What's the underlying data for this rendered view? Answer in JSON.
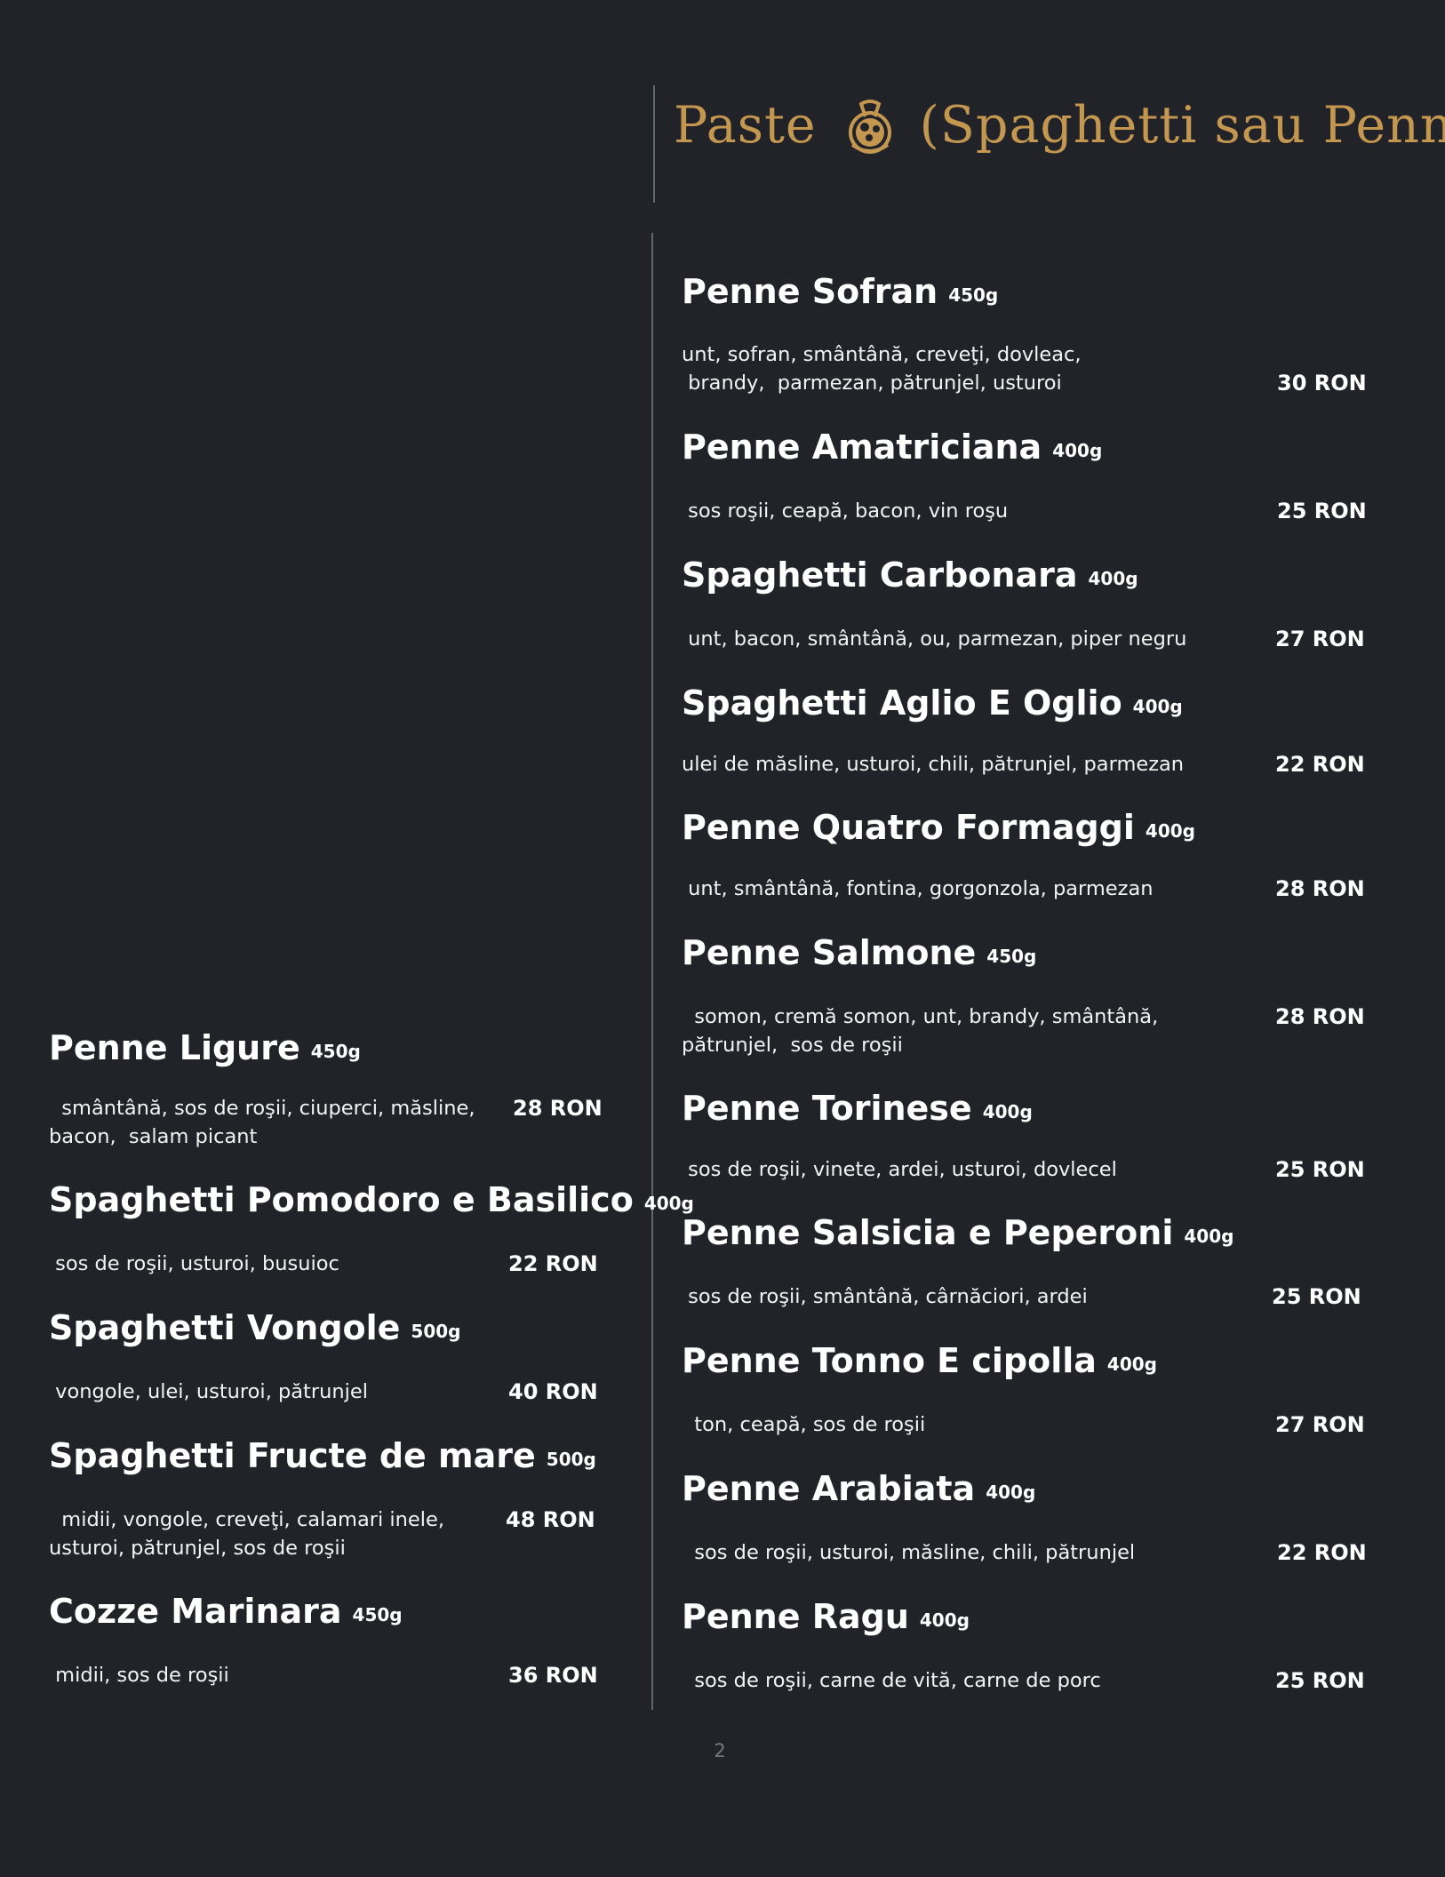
{
  "section": {
    "title_prefix": "Paste",
    "title_suffix": "(Spaghetti sau Penne)",
    "icon": "pasta-bowl-icon",
    "accent_color": "#c3974f",
    "background_color": "#212328"
  },
  "right_column": [
    {
      "name": "Penne Sofran",
      "weight": "450g",
      "desc1": "unt, sofran, smântână, creveţi, dovleac,",
      "desc2": " brandy,  parmezan, pătrunjel, usturoi",
      "price": "30 RON"
    },
    {
      "name": "Penne Amatriciana",
      "weight": "400g",
      "desc1": " sos roşii, ceapă, bacon, vin roşu",
      "desc2": "",
      "price": "25 RON"
    },
    {
      "name": "Spaghetti Carbonara",
      "weight": "400g",
      "desc1": " unt, bacon, smântână, ou, parmezan, piper negru",
      "desc2": "",
      "price": "27 RON"
    },
    {
      "name": "Spaghetti Aglio E Oglio",
      "weight": "400g",
      "desc1": "ulei de măsline, usturoi, chili, pătrunjel, parmezan",
      "desc2": "",
      "price": "22 RON"
    },
    {
      "name": "Penne Quatro Formaggi",
      "weight": "400g",
      "desc1": " unt, smântână, fontina, gorgonzola, parmezan",
      "desc2": "",
      "price": "28 RON"
    },
    {
      "name": "Penne Salmone",
      "weight": "450g",
      "desc1": "  somon, cremă somon, unt, brandy, smântână,",
      "desc2": "pătrunjel,  sos de roşii",
      "price": "28 RON"
    },
    {
      "name": "Penne Torinese",
      "weight": "400g",
      "desc1": " sos de roşii, vinete, ardei, usturoi, dovlecel",
      "desc2": "",
      "price": "25 RON"
    },
    {
      "name": "Penne Salsicia e Peperoni",
      "weight": "400g",
      "desc1": " sos de roşii, smântână, cârnăciori, ardei",
      "desc2": "",
      "price": "25 RON"
    },
    {
      "name": "Penne Tonno E cipolla",
      "weight": "400g",
      "desc1": "  ton, ceapă, sos de roşii",
      "desc2": "",
      "price": "27 RON"
    },
    {
      "name": "Penne Arabiata",
      "weight": "400g",
      "desc1": "  sos de roşii, usturoi, măsline, chili, pătrunjel",
      "desc2": "",
      "price": "22 RON"
    },
    {
      "name": "Penne Ragu",
      "weight": "400g",
      "desc1": "  sos de roşii, carne de vită, carne de porc",
      "desc2": "",
      "price": "25 RON"
    }
  ],
  "left_column": [
    {
      "name": "Penne Ligure",
      "weight": "450g",
      "desc1": "  smântână, sos de roşii, ciuperci, măsline,",
      "desc2": "bacon,  salam picant",
      "price": "28 RON"
    },
    {
      "name": "Spaghetti Pomodoro e Basilico",
      "weight": "400g",
      "desc1": " sos de roşii, usturoi, busuioc",
      "desc2": "",
      "price": "22 RON"
    },
    {
      "name": "Spaghetti Vongole",
      "weight": "500g",
      "desc1": " vongole, ulei, usturoi, pătrunjel",
      "desc2": "",
      "price": "40 RON"
    },
    {
      "name": "Spaghetti Fructe de mare",
      "weight": "500g",
      "desc1": "  midii, vongole, creveţi, calamari inele,",
      "desc2": "usturoi, pătrunjel, sos de roşii",
      "price": "48 RON"
    },
    {
      "name": "Cozze Marinara",
      "weight": "450g",
      "desc1": " midii, sos de roşii",
      "desc2": "",
      "price": "36 RON"
    }
  ],
  "page_number": "2"
}
